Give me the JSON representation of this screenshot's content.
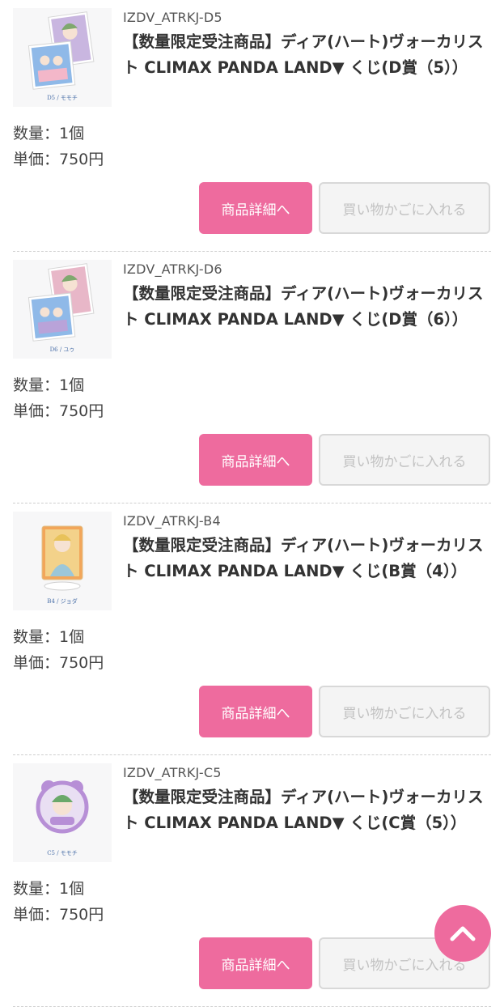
{
  "items": [
    {
      "code": "IZDV_ATRKJ-D5",
      "title": "【数量限定受注商品】ディア(ハート)ヴォーカリスト CLIMAX PANDA LAND▼ くじ(D賞（5））",
      "quantity": "数量：1個",
      "price": "単価：750円",
      "detail_button": "商品詳細へ",
      "cart_button": "買い物かごに入れる",
      "thumb_caption": "D5 / モモチ",
      "thumb_type": "cards",
      "colors": [
        "#c9b6e0",
        "#8fb9e8",
        "#f3b7c9"
      ]
    },
    {
      "code": "IZDV_ATRKJ-D6",
      "title": "【数量限定受注商品】ディア(ハート)ヴォーカリスト CLIMAX PANDA LAND▼ くじ(D賞（6））",
      "quantity": "数量：1個",
      "price": "単価：750円",
      "detail_button": "商品詳細へ",
      "cart_button": "買い物かごに入れる",
      "thumb_caption": "D6 / ユゥ",
      "thumb_type": "cards",
      "colors": [
        "#e8b7c8",
        "#8fb9e8",
        "#b9a3d9"
      ]
    },
    {
      "code": "IZDV_ATRKJ-B4",
      "title": "【数量限定受注商品】ディア(ハート)ヴォーカリスト CLIMAX PANDA LAND▼ くじ(B賞（4））",
      "quantity": "数量：1個",
      "price": "単価：750円",
      "detail_button": "商品詳細へ",
      "cart_button": "買い物かごに入れる",
      "thumb_caption": "B4 / ジョダ",
      "thumb_type": "stand",
      "colors": [
        "#f2a65a",
        "#f3d28a",
        "#9cc7d9"
      ]
    },
    {
      "code": "IZDV_ATRKJ-C5",
      "title": "【数量限定受注商品】ディア(ハート)ヴォーカリスト CLIMAX PANDA LAND▼ くじ(C賞（5））",
      "quantity": "数量：1個",
      "price": "単価：750円",
      "detail_button": "商品詳細へ",
      "cart_button": "買い物かごに入れる",
      "thumb_caption": "C5 / モモチ",
      "thumb_type": "badge",
      "colors": [
        "#b78fd6",
        "#e9dff3",
        "#6aa86a"
      ]
    }
  ],
  "scroll_top_icon": "chevron-up-icon",
  "accent_color": "#ee6b9e"
}
